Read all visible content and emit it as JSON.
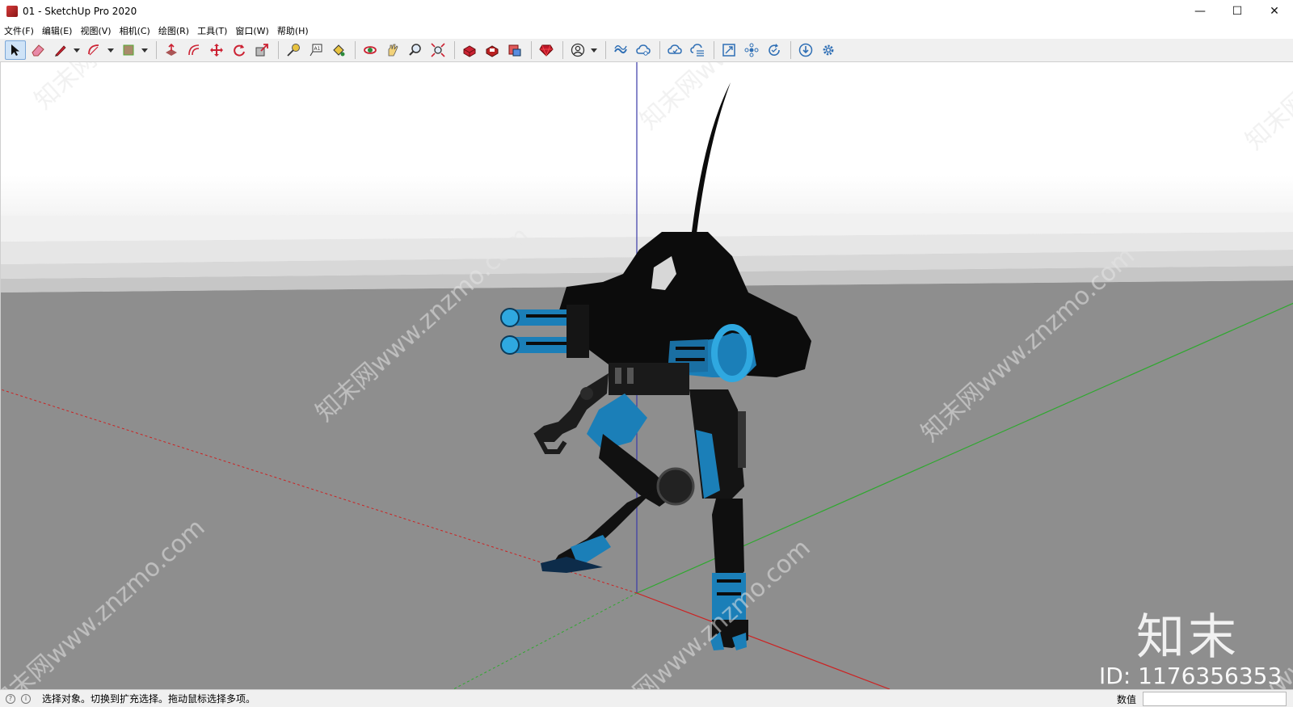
{
  "window": {
    "title": "01 - SketchUp Pro 2020",
    "controls": {
      "minimize": "—",
      "maximize": "☐",
      "close": "✕"
    }
  },
  "menu": [
    {
      "label": "文件(F)"
    },
    {
      "label": "编辑(E)"
    },
    {
      "label": "视图(V)"
    },
    {
      "label": "相机(C)"
    },
    {
      "label": "绘图(R)"
    },
    {
      "label": "工具(T)"
    },
    {
      "label": "窗口(W)"
    },
    {
      "label": "帮助(H)"
    }
  ],
  "toolbar": {
    "groups": [
      [
        "select-icon",
        "eraser-icon",
        "pencil-icon",
        "arc-icon",
        "rectangle-icon"
      ],
      [
        "push-pull-icon",
        "offset-icon",
        "move-icon",
        "rotate-icon",
        "scale-icon"
      ],
      [
        "tape-measure-icon",
        "text-icon",
        "paint-bucket-icon"
      ],
      [
        "orbit-icon",
        "pan-icon",
        "zoom-icon",
        "zoom-extents-icon"
      ],
      [
        "3d-warehouse-icon",
        "extension-warehouse-icon",
        "layout-icon"
      ],
      [
        "ruby-icon"
      ],
      [
        "account-icon"
      ],
      [
        "trimble-connect-icon",
        "cloud-share-icon",
        "cloud-sync-icon",
        "cloud-list-icon"
      ],
      [
        "solid-inspector-icon",
        "component-icon",
        "refresh-icon"
      ],
      [
        "download-icon",
        "settings-icon"
      ]
    ],
    "active": "select-icon",
    "colors": {
      "red": "#c0392b",
      "blue": "#2f6fb5",
      "dark": "#333333"
    }
  },
  "viewport": {
    "sky_color": "#ffffff",
    "ground_color": "#8e8e8e",
    "axis_colors": {
      "red": "#cc2222",
      "green": "#22aa22",
      "blue": "#2222aa"
    },
    "model_colors": {
      "body": "#0c0c0c",
      "accent": "#1b7fb8",
      "glow": "#2fa8e0"
    },
    "watermark_text": "知末网www.znzmo.com",
    "brand_mark": "知末",
    "id_label": "ID: 1176356353"
  },
  "status": {
    "message": "选择对象。切换到扩充选择。拖动鼠标选择多项。",
    "measure_label": "数值",
    "measure_value": ""
  }
}
